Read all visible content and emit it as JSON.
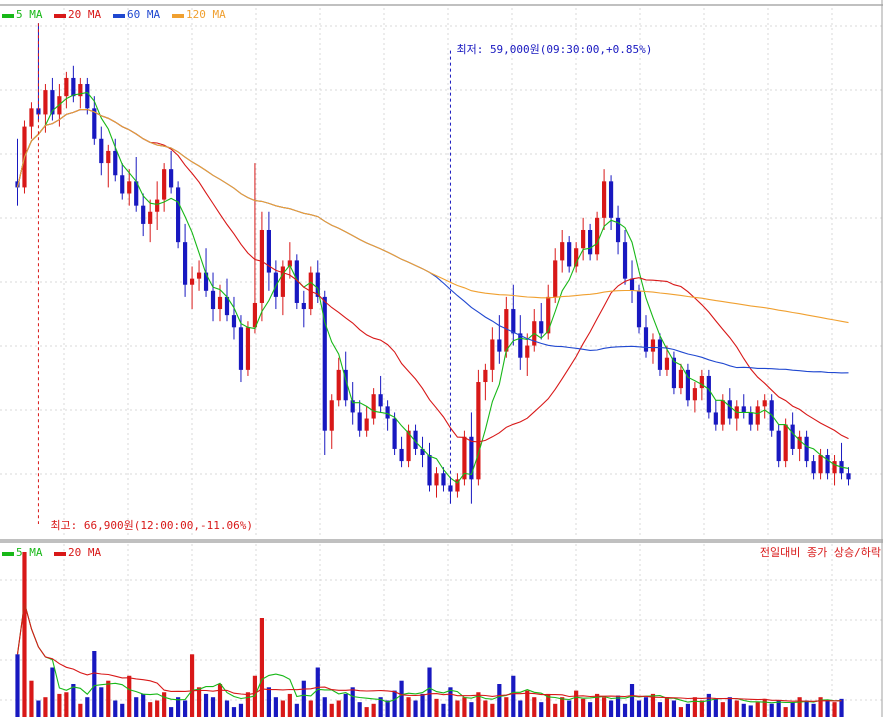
{
  "price_panel": {
    "legend": [
      {
        "label": "5 MA",
        "color": "#18b818"
      },
      {
        "label": "20 MA",
        "color": "#d81818"
      },
      {
        "label": "60 MA",
        "color": "#2048d0"
      },
      {
        "label": "120 MA",
        "color": "#f0a030"
      }
    ],
    "low_annotation": "최저: 59,000원(09:30:00,+0.85%)",
    "high_annotation": "최고: 66,900원(12:00:00,-11.06%)"
  },
  "volume_panel": {
    "legend": [
      {
        "label": "5 MA",
        "color": "#18b818"
      },
      {
        "label": "20 MA",
        "color": "#d81818"
      }
    ],
    "note": "전일대비 종가 상승/하락"
  },
  "chart_data": [
    {
      "type": "candlestick",
      "panel": "price",
      "note": "Intraday candles; values approximate, in won; up candles red, down candles blue",
      "high": 66900,
      "low": 59000,
      "candles": [
        [
          64300,
          65000,
          63900,
          64200
        ],
        [
          64200,
          65300,
          64100,
          65200
        ],
        [
          65200,
          65600,
          65000,
          65500
        ],
        [
          65500,
          66900,
          65300,
          65400
        ],
        [
          65400,
          65900,
          65100,
          65800
        ],
        [
          65800,
          66000,
          65300,
          65400
        ],
        [
          65400,
          65900,
          65200,
          65700
        ],
        [
          65700,
          66100,
          65500,
          66000
        ],
        [
          66000,
          66200,
          65600,
          65700
        ],
        [
          65700,
          66000,
          65500,
          65900
        ],
        [
          65900,
          66000,
          65400,
          65500
        ],
        [
          65500,
          65700,
          64900,
          65000
        ],
        [
          65000,
          65200,
          64400,
          64600
        ],
        [
          64600,
          64900,
          64200,
          64800
        ],
        [
          64800,
          65000,
          64300,
          64400
        ],
        [
          64400,
          64600,
          64000,
          64100
        ],
        [
          64100,
          64500,
          63900,
          64300
        ],
        [
          64300,
          64700,
          63800,
          63900
        ],
        [
          63900,
          64100,
          63400,
          63600
        ],
        [
          63600,
          64000,
          63300,
          63800
        ],
        [
          63800,
          64300,
          63500,
          64000
        ],
        [
          64000,
          64600,
          63800,
          64500
        ],
        [
          64500,
          64800,
          64100,
          64200
        ],
        [
          64200,
          64300,
          63200,
          63300
        ],
        [
          63300,
          63600,
          62400,
          62600
        ],
        [
          62600,
          62900,
          62200,
          62700
        ],
        [
          62700,
          63000,
          62500,
          62800
        ],
        [
          62800,
          63200,
          62400,
          62500
        ],
        [
          62500,
          62800,
          62000,
          62200
        ],
        [
          62200,
          62600,
          62000,
          62400
        ],
        [
          62400,
          62700,
          62000,
          62100
        ],
        [
          62100,
          62400,
          61700,
          61900
        ],
        [
          61900,
          62100,
          61000,
          61200
        ],
        [
          61200,
          62000,
          61100,
          61900
        ],
        [
          61900,
          64600,
          61800,
          62300
        ],
        [
          62300,
          63800,
          62000,
          63500
        ],
        [
          63500,
          63800,
          62500,
          62800
        ],
        [
          62800,
          63000,
          62200,
          62400
        ],
        [
          62400,
          63000,
          62100,
          62900
        ],
        [
          62900,
          63300,
          62700,
          63000
        ],
        [
          63000,
          63100,
          62200,
          62300
        ],
        [
          62300,
          62500,
          61900,
          62200
        ],
        [
          62200,
          62900,
          62100,
          62800
        ],
        [
          62800,
          63000,
          62300,
          62400
        ],
        [
          62400,
          62500,
          59800,
          60200
        ],
        [
          60200,
          60800,
          59900,
          60700
        ],
        [
          60700,
          61400,
          60600,
          61200
        ],
        [
          61200,
          61500,
          60600,
          60700
        ],
        [
          60700,
          61000,
          60300,
          60500
        ],
        [
          60500,
          60700,
          60100,
          60200
        ],
        [
          60200,
          60600,
          60100,
          60400
        ],
        [
          60400,
          60900,
          60300,
          60800
        ],
        [
          60800,
          61100,
          60500,
          60600
        ],
        [
          60600,
          60700,
          60200,
          60400
        ],
        [
          60400,
          60500,
          59800,
          59900
        ],
        [
          59900,
          60100,
          59600,
          59700
        ],
        [
          59700,
          60300,
          59600,
          60200
        ],
        [
          60200,
          60300,
          59800,
          59900
        ],
        [
          59900,
          60100,
          59600,
          59800
        ],
        [
          59800,
          60000,
          59200,
          59300
        ],
        [
          59300,
          59600,
          59100,
          59500
        ],
        [
          59500,
          59600,
          59200,
          59300
        ],
        [
          59300,
          59400,
          59000,
          59200
        ],
        [
          59200,
          59500,
          59100,
          59400
        ],
        [
          59400,
          60200,
          59300,
          60100
        ],
        [
          60100,
          60500,
          59000,
          59400
        ],
        [
          59400,
          61200,
          59300,
          61000
        ],
        [
          61000,
          61300,
          60700,
          61200
        ],
        [
          61200,
          61900,
          61000,
          61700
        ],
        [
          61700,
          62100,
          61300,
          61500
        ],
        [
          61500,
          62400,
          61400,
          62200
        ],
        [
          62200,
          62600,
          61600,
          61800
        ],
        [
          61800,
          62100,
          61200,
          61400
        ],
        [
          61400,
          61800,
          61100,
          61600
        ],
        [
          61600,
          62200,
          61500,
          62000
        ],
        [
          62000,
          62300,
          61700,
          61800
        ],
        [
          61800,
          62600,
          61700,
          62400
        ],
        [
          62400,
          63200,
          62300,
          63000
        ],
        [
          63000,
          63500,
          62800,
          63300
        ],
        [
          63300,
          63400,
          62800,
          62900
        ],
        [
          62900,
          63300,
          62800,
          63200
        ],
        [
          63200,
          63700,
          63000,
          63500
        ],
        [
          63500,
          63600,
          63000,
          63100
        ],
        [
          63100,
          63800,
          63000,
          63700
        ],
        [
          63700,
          64500,
          63500,
          64300
        ],
        [
          64300,
          64400,
          63500,
          63700
        ],
        [
          63700,
          63900,
          63100,
          63300
        ],
        [
          63300,
          63500,
          62600,
          62700
        ],
        [
          62700,
          63000,
          62300,
          62500
        ],
        [
          62500,
          62600,
          61800,
          61900
        ],
        [
          61900,
          62100,
          61400,
          61500
        ],
        [
          61500,
          61800,
          61300,
          61700
        ],
        [
          61700,
          61800,
          61100,
          61200
        ],
        [
          61200,
          61600,
          61100,
          61400
        ],
        [
          61400,
          61500,
          60800,
          60900
        ],
        [
          60900,
          61300,
          60800,
          61200
        ],
        [
          61200,
          61300,
          60600,
          60700
        ],
        [
          60700,
          61000,
          60500,
          60900
        ],
        [
          60900,
          61200,
          60700,
          61100
        ],
        [
          61100,
          61200,
          60400,
          60500
        ],
        [
          60500,
          60700,
          60200,
          60300
        ],
        [
          60300,
          60800,
          60200,
          60700
        ],
        [
          60700,
          60900,
          60300,
          60400
        ],
        [
          60400,
          60700,
          60200,
          60600
        ],
        [
          60600,
          60800,
          60400,
          60500
        ],
        [
          60500,
          60600,
          60200,
          60300
        ],
        [
          60300,
          60700,
          60200,
          60600
        ],
        [
          60600,
          60800,
          60400,
          60700
        ],
        [
          60700,
          60800,
          60100,
          60200
        ],
        [
          60200,
          60300,
          59600,
          59700
        ],
        [
          59700,
          60400,
          59600,
          60300
        ],
        [
          60300,
          60500,
          59800,
          59900
        ],
        [
          59900,
          60200,
          59700,
          60100
        ],
        [
          60100,
          60200,
          59600,
          59700
        ],
        [
          59700,
          59800,
          59400,
          59500
        ],
        [
          59500,
          59900,
          59400,
          59800
        ],
        [
          59800,
          59900,
          59400,
          59500
        ],
        [
          59500,
          59800,
          59300,
          59700
        ],
        [
          59700,
          60000,
          59400,
          59500
        ],
        [
          59500,
          59600,
          59300,
          59400
        ]
      ]
    },
    {
      "type": "bar",
      "panel": "volume",
      "note": "Volume bars, relative units",
      "values": [
        38,
        100,
        22,
        10,
        12,
        30,
        14,
        15,
        20,
        8,
        12,
        40,
        18,
        22,
        10,
        8,
        25,
        12,
        14,
        9,
        10,
        15,
        6,
        12,
        10,
        38,
        18,
        14,
        12,
        20,
        10,
        6,
        8,
        15,
        25,
        60,
        18,
        12,
        10,
        14,
        8,
        22,
        10,
        30,
        12,
        8,
        10,
        14,
        18,
        9,
        6,
        8,
        12,
        10,
        16,
        22,
        12,
        10,
        14,
        30,
        11,
        8,
        18,
        10,
        12,
        9,
        15,
        10,
        8,
        20,
        12,
        25,
        10,
        16,
        12,
        9,
        14,
        8,
        12,
        10,
        16,
        11,
        9,
        14,
        12,
        10,
        13,
        8,
        20,
        10,
        12,
        14,
        9,
        12,
        10,
        6,
        8,
        12,
        10,
        14,
        11,
        9,
        12,
        10,
        8,
        7,
        9,
        11,
        8,
        10,
        6,
        9,
        12,
        10,
        8,
        12,
        10,
        9,
        11
      ]
    }
  ]
}
